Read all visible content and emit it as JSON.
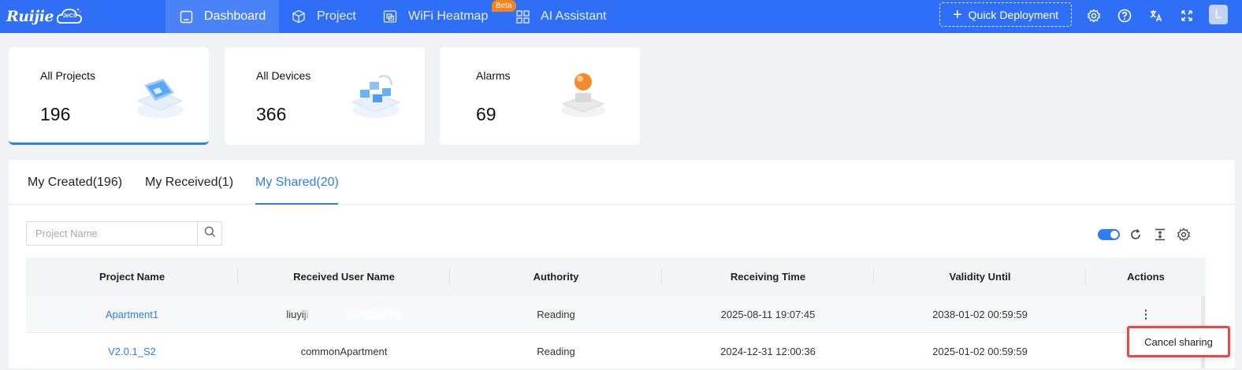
{
  "brand": {
    "logo_text": "Ruijie",
    "logo_badge": "JeCS"
  },
  "nav": {
    "items": [
      {
        "label": "Dashboard",
        "icon": "home-icon",
        "active": true
      },
      {
        "label": "Project",
        "icon": "cube-icon",
        "active": false
      },
      {
        "label": "WiFi Heatmap",
        "icon": "heatmap-icon",
        "active": false,
        "badge": "Beta"
      },
      {
        "label": "AI Assistant",
        "icon": "grid-icon",
        "active": false
      }
    ],
    "quick_deployment": "Quick Deployment",
    "avatar_letter": "L"
  },
  "cards": [
    {
      "label": "All Projects",
      "value": "196"
    },
    {
      "label": "All Devices",
      "value": "366"
    },
    {
      "label": "Alarms",
      "value": "69"
    }
  ],
  "tabs": [
    {
      "label": "My Created(196)",
      "active": false
    },
    {
      "label": "My Received(1)",
      "active": false
    },
    {
      "label": "My Shared(20)",
      "active": true
    }
  ],
  "search": {
    "placeholder": "Project Name",
    "value": ""
  },
  "table": {
    "columns": [
      "Project Name",
      "Received User Name",
      "Authority",
      "Receiving Time",
      "Validity Until",
      "Actions"
    ],
    "rows": [
      {
        "project": "Apartment1",
        "user": "liuyiji",
        "authority": "Reading",
        "receiving_time": "2025-08-11 19:07:45",
        "validity": "2038-01-02 00:59:59",
        "actions": "⋮"
      },
      {
        "project": "V2.0.1_S2",
        "user": "commonApartment",
        "authority": "Reading",
        "receiving_time": "2024-12-31 12:00:36",
        "validity": "2025-01-02 00:59:59",
        "actions": ""
      }
    ]
  },
  "action_menu": {
    "cancel_sharing": "Cancel sharing"
  },
  "colors": {
    "primary": "#2f6ff7",
    "link": "#2f7cf6",
    "highlight_border": "#e34b4b",
    "beta_badge": "#f5841f"
  }
}
